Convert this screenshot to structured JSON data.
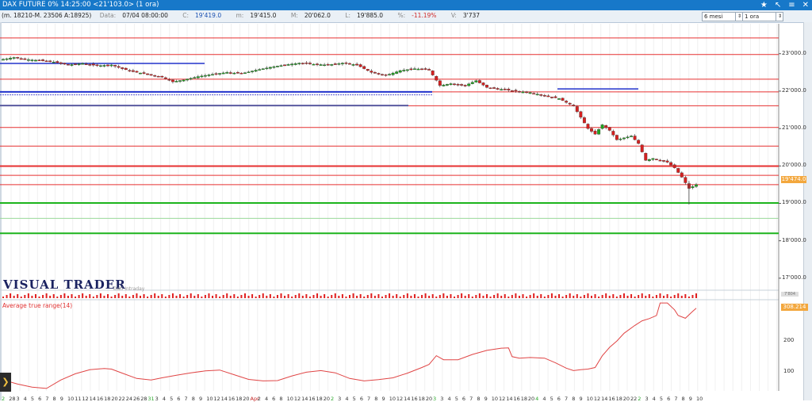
{
  "window": {
    "title": "DAX FUTURE 0%  14:25:00  <21'103.0>  (1 ora)",
    "controls": [
      "★",
      "↖",
      "≡",
      "✕"
    ]
  },
  "toolbar": {
    "range_info": "(m. 18210-M. 23506 A:18925)",
    "data_label": "Data:",
    "data_value": "07/04 08:00:00",
    "close_label": "C:",
    "close_value": "19'419.0",
    "min_label": "m:",
    "min_value": "19'415.0",
    "max_label": "M:",
    "max_value": "20'062.0",
    "l_label": "L:",
    "l_value": "19'885.0",
    "pct_label": "%:",
    "pct_value": "-11.19%",
    "v_label": "V:",
    "v_value": "3'737",
    "period_select": "6 mesi",
    "timeframe_select": "1 ora"
  },
  "chart_data": {
    "type": "candlestick",
    "price_axis": {
      "ticks": [
        17000,
        18000,
        19000,
        20000,
        21000,
        22000,
        23000
      ],
      "ylim": [
        16700,
        23800
      ]
    },
    "current_price_tag": "19'474.0",
    "support_resistance_lines": {
      "red": [
        23420,
        22980,
        22320,
        21980,
        21610,
        21030,
        20530,
        19995,
        19750,
        19500
      ],
      "green": [
        19010,
        18200
      ]
    },
    "close_path": [
      [
        0,
        22850
      ],
      [
        3,
        22900
      ],
      [
        6,
        22850
      ],
      [
        10,
        22820
      ],
      [
        14,
        22780
      ],
      [
        18,
        22700
      ],
      [
        22,
        22740
      ],
      [
        26,
        22680
      ],
      [
        30,
        22700
      ],
      [
        33,
        22600
      ],
      [
        36,
        22520
      ],
      [
        40,
        22450
      ],
      [
        44,
        22380
      ],
      [
        47,
        22250
      ],
      [
        50,
        22300
      ],
      [
        54,
        22390
      ],
      [
        58,
        22450
      ],
      [
        62,
        22500
      ],
      [
        66,
        22470
      ],
      [
        70,
        22560
      ],
      [
        74,
        22640
      ],
      [
        78,
        22700
      ],
      [
        82,
        22750
      ],
      [
        86,
        22720
      ],
      [
        90,
        22700
      ],
      [
        94,
        22750
      ],
      [
        98,
        22700
      ],
      [
        102,
        22500
      ],
      [
        106,
        22420
      ],
      [
        110,
        22550
      ],
      [
        114,
        22600
      ],
      [
        118,
        22570
      ],
      [
        121,
        22150
      ],
      [
        124,
        22200
      ],
      [
        128,
        22150
      ],
      [
        131,
        22280
      ],
      [
        134,
        22100
      ],
      [
        138,
        22050
      ],
      [
        142,
        22000
      ],
      [
        146,
        21960
      ],
      [
        150,
        21880
      ],
      [
        154,
        21800
      ],
      [
        158,
        21600
      ],
      [
        160,
        21300
      ],
      [
        162,
        21000
      ],
      [
        164,
        20850
      ],
      [
        166,
        21100
      ],
      [
        168,
        20950
      ],
      [
        170,
        20700
      ],
      [
        172,
        20750
      ],
      [
        174,
        20800
      ],
      [
        176,
        20600
      ],
      [
        178,
        20150
      ],
      [
        180,
        20200
      ],
      [
        182,
        20150
      ],
      [
        184,
        20100
      ],
      [
        186,
        19950
      ],
      [
        188,
        19700
      ],
      [
        190,
        19400
      ],
      [
        192,
        19500
      ]
    ],
    "atr_indicator": {
      "name": "Average true range(14)",
      "value_tag": "308.214",
      "ticks": [
        100,
        200,
        300
      ],
      "ylim": [
        40,
        330
      ],
      "values": [
        [
          0,
          75
        ],
        [
          4,
          62
        ],
        [
          8,
          52
        ],
        [
          12,
          48
        ],
        [
          16,
          75
        ],
        [
          20,
          95
        ],
        [
          24,
          108
        ],
        [
          28,
          112
        ],
        [
          30,
          110
        ],
        [
          33,
          97
        ],
        [
          37,
          80
        ],
        [
          41,
          75
        ],
        [
          44,
          82
        ],
        [
          48,
          90
        ],
        [
          52,
          98
        ],
        [
          56,
          104
        ],
        [
          60,
          107
        ],
        [
          64,
          92
        ],
        [
          68,
          77
        ],
        [
          72,
          72
        ],
        [
          76,
          73
        ],
        [
          80,
          88
        ],
        [
          84,
          100
        ],
        [
          88,
          105
        ],
        [
          92,
          98
        ],
        [
          96,
          80
        ],
        [
          100,
          72
        ],
        [
          104,
          76
        ],
        [
          108,
          82
        ],
        [
          112,
          97
        ],
        [
          116,
          115
        ],
        [
          118,
          125
        ],
        [
          120,
          153
        ],
        [
          122,
          140
        ],
        [
          126,
          140
        ],
        [
          130,
          157
        ],
        [
          134,
          170
        ],
        [
          138,
          177
        ],
        [
          140,
          178
        ],
        [
          141,
          150
        ],
        [
          143,
          145
        ],
        [
          146,
          147
        ],
        [
          150,
          145
        ],
        [
          153,
          130
        ],
        [
          156,
          113
        ],
        [
          158,
          105
        ],
        [
          160,
          108
        ],
        [
          162,
          110
        ],
        [
          164,
          115
        ],
        [
          166,
          153
        ],
        [
          168,
          180
        ],
        [
          170,
          200
        ],
        [
          172,
          225
        ],
        [
          175,
          250
        ],
        [
          177,
          265
        ],
        [
          179,
          272
        ],
        [
          181,
          282
        ],
        [
          182,
          322
        ],
        [
          184,
          322
        ],
        [
          186,
          300
        ],
        [
          187,
          282
        ],
        [
          189,
          273
        ],
        [
          191,
          295
        ],
        [
          192,
          305
        ]
      ]
    },
    "x_tick_labels": [
      {
        "t": "2",
        "c": "g"
      },
      {
        "t": "28"
      },
      {
        "t": "3"
      },
      {
        "t": "4"
      },
      {
        "t": "5"
      },
      {
        "t": "6"
      },
      {
        "t": "7"
      },
      {
        "t": "8"
      },
      {
        "t": "9"
      },
      {
        "t": "10"
      },
      {
        "t": "11"
      },
      {
        "t": "12"
      },
      {
        "t": "14"
      },
      {
        "t": "16"
      },
      {
        "t": "18"
      },
      {
        "t": "20"
      },
      {
        "t": "22"
      },
      {
        "t": "24"
      },
      {
        "t": "26"
      },
      {
        "t": "28"
      },
      {
        "t": "31",
        "c": "g"
      },
      {
        "t": "3"
      },
      {
        "t": "4"
      },
      {
        "t": "5"
      },
      {
        "t": "6"
      },
      {
        "t": "7"
      },
      {
        "t": "8"
      },
      {
        "t": "9"
      },
      {
        "t": "10"
      },
      {
        "t": "12"
      },
      {
        "t": "14"
      },
      {
        "t": "16"
      },
      {
        "t": "18"
      },
      {
        "t": "20"
      },
      {
        "t": "Apr",
        "c": "r"
      },
      {
        "t": "2"
      },
      {
        "t": "4"
      },
      {
        "t": "6"
      },
      {
        "t": "8"
      },
      {
        "t": "10"
      },
      {
        "t": "12"
      },
      {
        "t": "14"
      },
      {
        "t": "16"
      },
      {
        "t": "18"
      },
      {
        "t": "20"
      },
      {
        "t": "2",
        "c": "g"
      },
      {
        "t": "3"
      },
      {
        "t": "4"
      },
      {
        "t": "5"
      },
      {
        "t": "6"
      },
      {
        "t": "7"
      },
      {
        "t": "8"
      },
      {
        "t": "9"
      },
      {
        "t": "10"
      },
      {
        "t": "12"
      },
      {
        "t": "14"
      },
      {
        "t": "16"
      },
      {
        "t": "18"
      },
      {
        "t": "20"
      },
      {
        "t": "3",
        "c": "g"
      },
      {
        "t": "3"
      },
      {
        "t": "4"
      },
      {
        "t": "5"
      },
      {
        "t": "6"
      },
      {
        "t": "7"
      },
      {
        "t": "8"
      },
      {
        "t": "9"
      },
      {
        "t": "10"
      },
      {
        "t": "12"
      },
      {
        "t": "14"
      },
      {
        "t": "16"
      },
      {
        "t": "18"
      },
      {
        "t": "20"
      },
      {
        "t": "4",
        "c": "g"
      },
      {
        "t": "4"
      },
      {
        "t": "5"
      },
      {
        "t": "6"
      },
      {
        "t": "7"
      },
      {
        "t": "8"
      },
      {
        "t": "9"
      },
      {
        "t": "10"
      },
      {
        "t": "12"
      },
      {
        "t": "14"
      },
      {
        "t": "16"
      },
      {
        "t": "18"
      },
      {
        "t": "20"
      },
      {
        "t": "22"
      },
      {
        "t": "2",
        "c": "g"
      },
      {
        "t": "3"
      },
      {
        "t": "4"
      },
      {
        "t": "5"
      },
      {
        "t": "6"
      },
      {
        "t": "7"
      },
      {
        "t": "8"
      },
      {
        "t": "9"
      },
      {
        "t": "10"
      }
    ]
  },
  "logo": {
    "text": "VISUAL TRADER",
    "subtitle": "Dati Intraday"
  },
  "volume_tag": "7'804",
  "colors": {
    "bull": "#1fa31f",
    "bear": "#d42020",
    "sr_red": "#e63030",
    "sr_green": "#1cb41c",
    "title_bg": "#1778c9",
    "tag": "#f3a73d",
    "blue_line": "#2233cc"
  }
}
